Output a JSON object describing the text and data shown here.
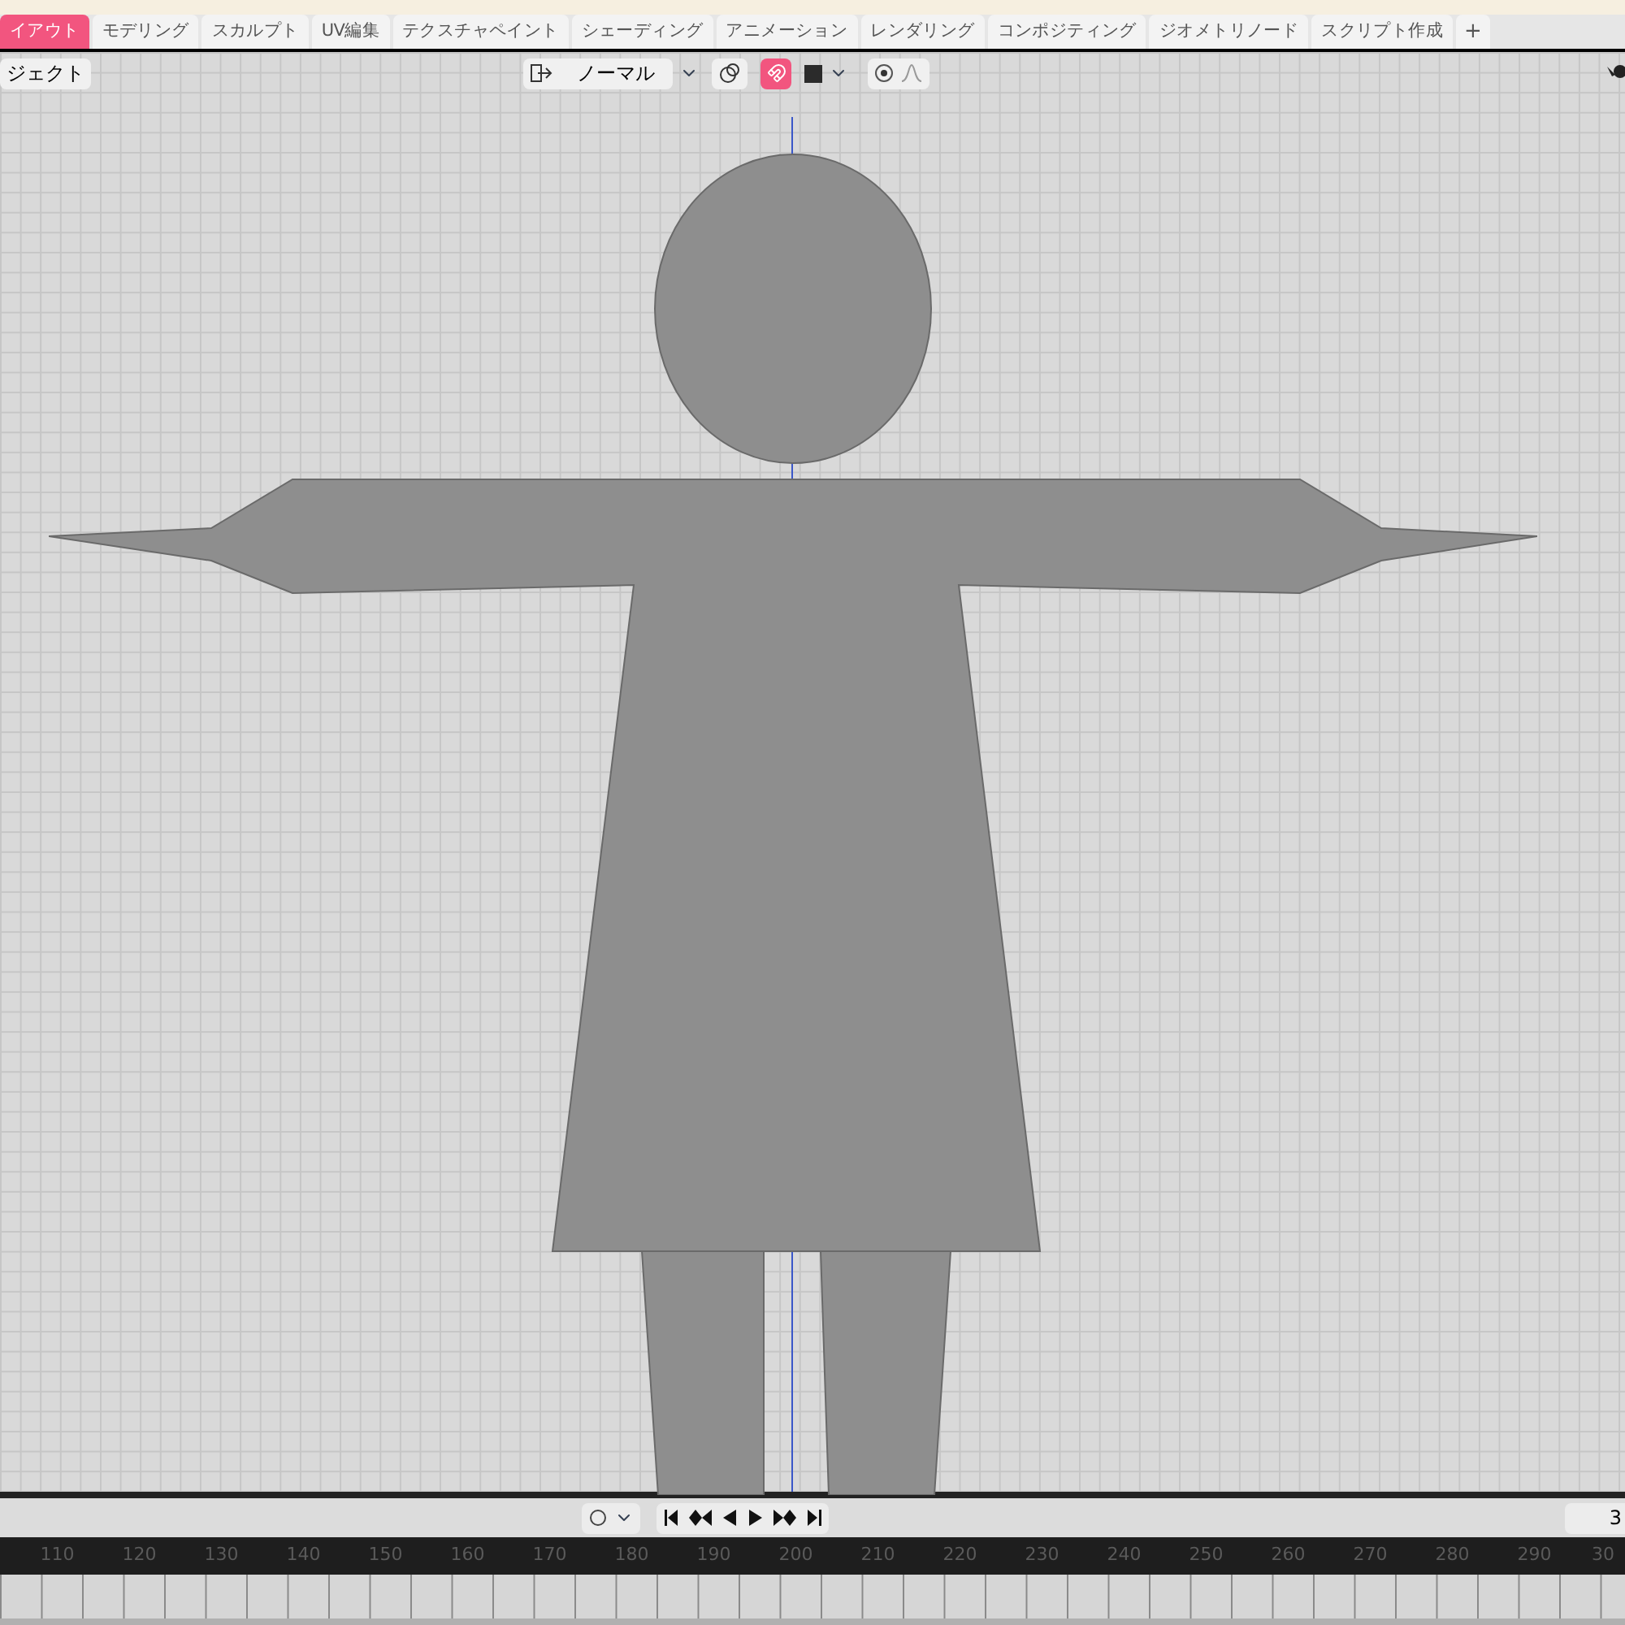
{
  "workspace_tabs": [
    {
      "label": "イアウト",
      "selected": true
    },
    {
      "label": "モデリング",
      "selected": false
    },
    {
      "label": "スカルプト",
      "selected": false
    },
    {
      "label": "UV編集",
      "selected": false
    },
    {
      "label": "テクスチャペイント",
      "selected": false
    },
    {
      "label": "シェーディング",
      "selected": false
    },
    {
      "label": "アニメーション",
      "selected": false
    },
    {
      "label": "レンダリング",
      "selected": false
    },
    {
      "label": "コンポジティング",
      "selected": false
    },
    {
      "label": "ジオメトリノード",
      "selected": false
    },
    {
      "label": "スクリプト作成",
      "selected": false
    }
  ],
  "add_tab": "+",
  "viewport_header": {
    "mode": "ジェクト",
    "orientation": "ノーマル",
    "snap_on": true
  },
  "timeline": {
    "frame_field": "3",
    "ruler": [
      "110",
      "120",
      "130",
      "140",
      "150",
      "160",
      "170",
      "180",
      "190",
      "200",
      "210",
      "220",
      "230",
      "240",
      "250",
      "260",
      "270",
      "280",
      "290",
      "30"
    ]
  }
}
